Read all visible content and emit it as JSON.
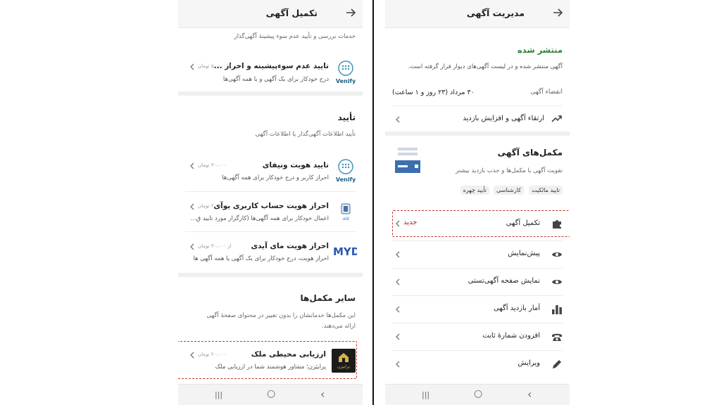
{
  "left": {
    "title": "تکمیل آگهی",
    "intro": "خدمات بررسی و تأیید عدم سوء پیشینهٔ آگهی‌گذار",
    "items_top": [
      {
        "title": "تایید عدم سوءپیشینه و احراز ...",
        "price": "از ۵۰،۰۰۰ تومان",
        "desc": "درج خودکار برای یک آگهی و یا همه آگهی‌ها",
        "logo": "Venify"
      }
    ],
    "verify_heading": "تأیید",
    "verify_sub": "تأیید اطلاعات آگهی‌گذار یا اطلاعات آگهی",
    "verify_items": [
      {
        "title": "تایید هویت ونیفای",
        "price": "۳۰،۰۰۰ تومان",
        "desc": "احراز کاربر و درج خودکار برای همه آگهی‌ها",
        "logo": "Venify"
      },
      {
        "title": "احراز هویت حساب کاربری یوآی",
        "price": "۲۰۰،۰۰۰ تومان",
        "desc": "اعمال خودکار برای همه آگهی‌ها (کارگزار مورد تایید ق...",
        "logo": "uid"
      },
      {
        "title": "احراز هویت مای آیدی",
        "price": "از ۳۰،۰۰۰ تومان",
        "desc": "احراز هویت، درج خودکار برای یک آگهی یا همه آگهی ها",
        "logo": "MYD"
      }
    ],
    "other_heading": "سایر مکمل‌ها",
    "other_sub1": "این مکمل‌ها خدماتشان را بدون تغییر در محتوای صفحهٔ آگهی",
    "other_sub2": "ارائه می‌دهند.",
    "other_items": [
      {
        "title": "ارزیابی محیطی ملک",
        "price": "۲۰،۰۰۰ تومان",
        "desc": "پرایپَزن؛ مشاور هوشمند شما در ارزیابی ملک",
        "logo": "پرایپزن"
      }
    ]
  },
  "right": {
    "title": "مدیریت آگهی",
    "status": "منتشر شده",
    "status_desc": "آگهی منتشر شده و در لیست آگهی‌های دیوار قرار گرفته است.",
    "expire_label": "انقضاء آگهی",
    "expire_value": "۳۰ مرداد (۲۳ روز و ۱ ساعت)",
    "promote": "ارتقاء آگهی و افزایش بازدید",
    "addons_title": "مکمل‌های آگهی",
    "addons_desc": "تقویت آگهی با مکمل‌ها و جذب بازدید بیشتر",
    "chips": [
      "تایید مالکیت",
      "کارشناسی",
      "تأیید چهره"
    ],
    "menu": [
      {
        "label": "تکمیل آگهی",
        "badge": "جدید",
        "icon": "puzzle-icon"
      },
      {
        "label": "پیش‌نمایش",
        "icon": "eye-icon"
      },
      {
        "label": "نمایش صفحه آگهی‌تستی",
        "icon": "eye-icon"
      },
      {
        "label": "آمار بازدید آگهی",
        "icon": "bar-chart-icon"
      },
      {
        "label": "افزودن شمارهٔ ثابت",
        "icon": "phone-icon"
      },
      {
        "label": "ویرایش",
        "icon": "pencil-icon"
      }
    ]
  },
  "colors": {
    "accent": "#a62626",
    "green": "#2e7d32",
    "sep": "#efefef"
  },
  "nav": {
    "recent": "|||",
    "home": "○",
    "back": "‹"
  }
}
